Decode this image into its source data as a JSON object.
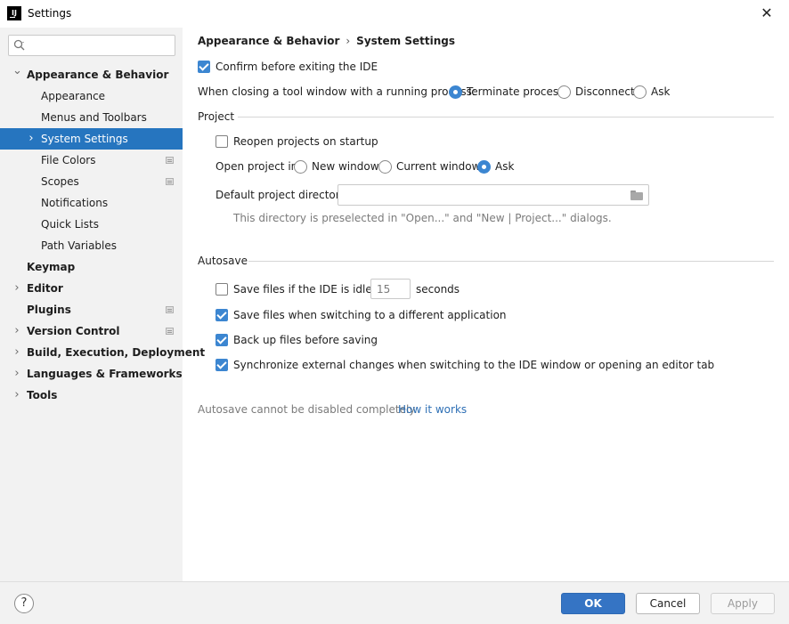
{
  "window": {
    "title": "Settings",
    "app_icon_text": "IJ",
    "close_glyph": "✕"
  },
  "sidebar": {
    "search": {
      "value": "",
      "placeholder": ""
    },
    "items": [
      {
        "label": "Appearance & Behavior",
        "level": 0,
        "bold": true,
        "arrow": "expanded",
        "selected": false,
        "doc_icon": false
      },
      {
        "label": "Appearance",
        "level": 1,
        "bold": false,
        "arrow": "none",
        "selected": false,
        "doc_icon": false
      },
      {
        "label": "Menus and Toolbars",
        "level": 1,
        "bold": false,
        "arrow": "none",
        "selected": false,
        "doc_icon": false
      },
      {
        "label": "System Settings",
        "level": 1,
        "bold": false,
        "arrow": "collapsed",
        "selected": true,
        "doc_icon": false
      },
      {
        "label": "File Colors",
        "level": 1,
        "bold": false,
        "arrow": "none",
        "selected": false,
        "doc_icon": true
      },
      {
        "label": "Scopes",
        "level": 1,
        "bold": false,
        "arrow": "none",
        "selected": false,
        "doc_icon": true
      },
      {
        "label": "Notifications",
        "level": 1,
        "bold": false,
        "arrow": "none",
        "selected": false,
        "doc_icon": false
      },
      {
        "label": "Quick Lists",
        "level": 1,
        "bold": false,
        "arrow": "none",
        "selected": false,
        "doc_icon": false
      },
      {
        "label": "Path Variables",
        "level": 1,
        "bold": false,
        "arrow": "none",
        "selected": false,
        "doc_icon": false
      },
      {
        "label": "Keymap",
        "level": 0,
        "bold": true,
        "arrow": "none",
        "selected": false,
        "doc_icon": false
      },
      {
        "label": "Editor",
        "level": 0,
        "bold": true,
        "arrow": "collapsed",
        "selected": false,
        "doc_icon": false
      },
      {
        "label": "Plugins",
        "level": 0,
        "bold": true,
        "arrow": "none",
        "selected": false,
        "doc_icon": true
      },
      {
        "label": "Version Control",
        "level": 0,
        "bold": true,
        "arrow": "collapsed",
        "selected": false,
        "doc_icon": true
      },
      {
        "label": "Build, Execution, Deployment",
        "level": 0,
        "bold": true,
        "arrow": "collapsed",
        "selected": false,
        "doc_icon": false
      },
      {
        "label": "Languages & Frameworks",
        "level": 0,
        "bold": true,
        "arrow": "collapsed",
        "selected": false,
        "doc_icon": false
      },
      {
        "label": "Tools",
        "level": 0,
        "bold": true,
        "arrow": "collapsed",
        "selected": false,
        "doc_icon": false
      }
    ]
  },
  "breadcrumb": {
    "parent": "Appearance & Behavior",
    "separator": "›",
    "current": "System Settings"
  },
  "general": {
    "confirm_exit": {
      "label": "Confirm before exiting the IDE",
      "checked": true
    },
    "tool_window_label": "When closing a tool window with a running process:",
    "tool_window_options": [
      {
        "label": "Terminate process",
        "selected": true
      },
      {
        "label": "Disconnect",
        "selected": false
      },
      {
        "label": "Ask",
        "selected": false
      }
    ]
  },
  "project": {
    "section_title": "Project",
    "reopen": {
      "label": "Reopen projects on startup",
      "checked": false
    },
    "open_in_label": "Open project in",
    "open_in_options": [
      {
        "label": "New window",
        "selected": false
      },
      {
        "label": "Current window",
        "selected": false
      },
      {
        "label": "Ask",
        "selected": true
      }
    ],
    "default_dir_label": "Default project directory:",
    "default_dir_value": "",
    "default_dir_hint": "This directory is preselected in \"Open...\" and \"New | Project...\" dialogs."
  },
  "autosave": {
    "section_title": "Autosave",
    "idle": {
      "label": "Save files if the IDE is idle for",
      "checked": false,
      "value": "15",
      "unit": "seconds"
    },
    "switch_app": {
      "label": "Save files when switching to a different application",
      "checked": true
    },
    "backup": {
      "label": "Back up files before saving",
      "checked": true
    },
    "sync": {
      "label": "Synchronize external changes when switching to the IDE window or opening an editor tab",
      "checked": true
    },
    "note": "Autosave cannot be disabled completely.",
    "link": "How it works"
  },
  "footer": {
    "help": "?",
    "ok": "OK",
    "cancel": "Cancel",
    "apply": "Apply"
  },
  "colors": {
    "accent": "#3c86d1",
    "selection": "#2675bf",
    "link": "#2d6fb5"
  }
}
